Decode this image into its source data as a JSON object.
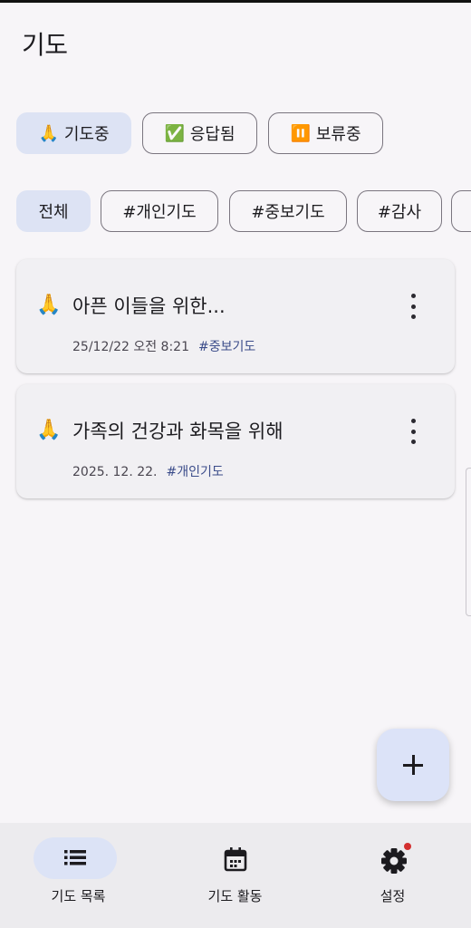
{
  "header": {
    "title": "기도"
  },
  "status_filters": [
    {
      "emoji": "🙏",
      "label": "기도중",
      "selected": true
    },
    {
      "emoji": "✅",
      "label": "응답됨",
      "selected": false
    },
    {
      "emoji": "⏸️",
      "label": "보류중",
      "selected": false
    }
  ],
  "tag_filters": [
    {
      "label": "전체",
      "selected": true
    },
    {
      "label": "#개인기도",
      "selected": false
    },
    {
      "label": "#중보기도",
      "selected": false
    },
    {
      "label": "#감사",
      "selected": false
    }
  ],
  "prayers": [
    {
      "emoji": "🙏",
      "title": "아픈 이들을 위한...",
      "date": "25/12/22 오전 8:21",
      "tag": "#중보기도"
    },
    {
      "emoji": "🙏",
      "title": "가족의 건강과 화목을 위해",
      "date": "2025. 12. 22.",
      "tag": "#개인기도"
    }
  ],
  "fab": {
    "icon": "plus-icon"
  },
  "bottom_nav": [
    {
      "label": "기도 목록",
      "icon": "list-icon",
      "active": true
    },
    {
      "label": "기도 활동",
      "icon": "calendar-icon",
      "active": false
    },
    {
      "label": "설정",
      "icon": "gear-icon",
      "active": false,
      "badge_color": "#d32f2f"
    }
  ],
  "colors": {
    "accent": "#dce3f6",
    "tag_text": "#3b4c8a",
    "background": "#f7f5f8"
  }
}
